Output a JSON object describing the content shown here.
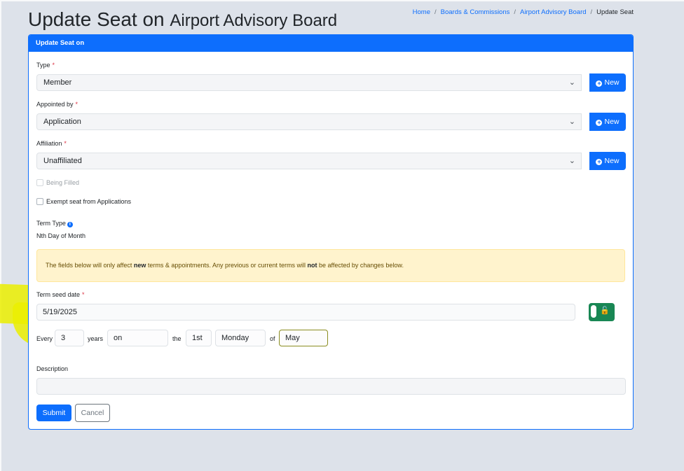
{
  "header": {
    "title_main": "Update Seat on",
    "title_sub": "Airport Advisory Board",
    "breadcrumb": [
      "Home",
      "Boards & Commissions",
      "Airport Advisory Board",
      "Update Seat"
    ]
  },
  "card": {
    "header": "Update Seat on"
  },
  "form": {
    "type": {
      "label": "Type",
      "value": "Member",
      "new_label": "New"
    },
    "appointed_by": {
      "label": "Appointed by",
      "value": "Application",
      "new_label": "New"
    },
    "affiliation": {
      "label": "Affiliation",
      "value": "Unaffiliated",
      "new_label": "New"
    },
    "being_filled": {
      "label": "Being Filled",
      "checked": false,
      "disabled": true
    },
    "exempt": {
      "label": "Exempt seat from Applications",
      "checked": false
    },
    "term_type": {
      "label": "Term Type",
      "value": "Nth Day of Month"
    },
    "alert": {
      "part1": "The fields below will only affect ",
      "bold1": "new",
      "part2": " terms & appointments. Any previous or current terms will ",
      "bold2": "not",
      "part3": " be affected by changes below."
    },
    "term_seed": {
      "label": "Term seed date",
      "value": "5/19/2025"
    },
    "recurrence": {
      "every_label": "Every",
      "every_value": "3",
      "years_label": "years",
      "on_value": "on",
      "the_label": "the",
      "nth_value": "1st",
      "weekday_value": "Monday",
      "of_label": "of",
      "month_value": "May"
    },
    "description": {
      "label": "Description",
      "value": ""
    },
    "submit_label": "Submit",
    "cancel_label": "Cancel"
  },
  "required_marker": "*",
  "icons": {
    "new": "plus-circle-icon",
    "chevron": "chevron-down-icon",
    "lock": "unlock-icon",
    "info": "info-icon"
  },
  "colors": {
    "primary": "#0d6efd",
    "success": "#198754",
    "highlight": "#ebee00",
    "alert_bg": "#fff3cd"
  }
}
